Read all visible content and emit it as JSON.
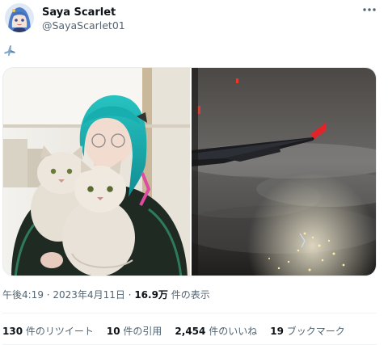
{
  "user": {
    "display_name": "Saya Scarlet",
    "handle": "@SayaScarlet01",
    "avatar_icon": "anime-avatar-blue-hair"
  },
  "post": {
    "text_emoji": "airplane-emoji",
    "media": [
      {
        "description_icon": "photo-woman-with-cats"
      },
      {
        "description_icon": "photo-airplane-wing-night-city"
      }
    ]
  },
  "meta": {
    "time": "午後4:19",
    "separator": " · ",
    "date": "2023年4月11日",
    "views_count": "16.9万",
    "views_label": " 件の表示"
  },
  "stats": {
    "retweets": {
      "count": "130",
      "label": " 件のリツイート"
    },
    "quotes": {
      "count": "10",
      "label": " 件の引用"
    },
    "likes": {
      "count": "2,454",
      "label": " 件のいいね"
    },
    "bookmarks": {
      "count": "19",
      "label": " ブックマーク"
    }
  },
  "colors": {
    "text_primary": "#0f1419",
    "text_secondary": "#536471",
    "divider": "#eff3f4",
    "hair_accent": "#1fb5b8",
    "wing_tip": "#e0242a"
  }
}
